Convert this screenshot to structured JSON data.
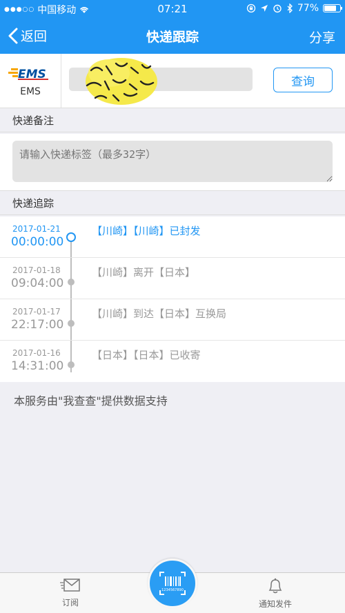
{
  "status_bar": {
    "carrier": "中国移动",
    "time": "07:21",
    "battery": "77%",
    "battery_level": 0.77
  },
  "nav": {
    "back_label": "返回",
    "title": "快递跟踪",
    "share_label": "分享"
  },
  "query": {
    "carrier_name": "EMS",
    "carrier_logo_text": "EMS",
    "query_button": "查询"
  },
  "sections": {
    "note_title": "快递备注",
    "tracking_title": "快递追踪"
  },
  "note": {
    "placeholder": "请输入快递标签（最多32字）"
  },
  "tracking": [
    {
      "date": "2017-01-21",
      "time": "00:00:00",
      "desc": "【川崎】【川崎】已封发",
      "active": true
    },
    {
      "date": "2017-01-18",
      "time": "09:04:00",
      "desc": "【川崎】离开【日本】",
      "active": false
    },
    {
      "date": "2017-01-17",
      "time": "22:17:00",
      "desc": "【川崎】到达【日本】互换局",
      "active": false
    },
    {
      "date": "2017-01-16",
      "time": "14:31:00",
      "desc": "【日本】【日本】已收寄",
      "active": false
    }
  ],
  "footer_note": "本服务由\"我查查\"提供数据支持",
  "tabs": {
    "subscribe": "订阅",
    "notify": "通知发件",
    "scan_caption": "1234567890"
  },
  "colors": {
    "accent": "#2196f3",
    "background": "#efeff4"
  },
  "icons": [
    "back-chevron-icon",
    "wifi-icon",
    "lock-rotation-icon",
    "location-icon",
    "alarm-icon",
    "bluetooth-icon",
    "battery-icon",
    "mail-icon",
    "barcode-scan-icon",
    "bell-icon"
  ]
}
